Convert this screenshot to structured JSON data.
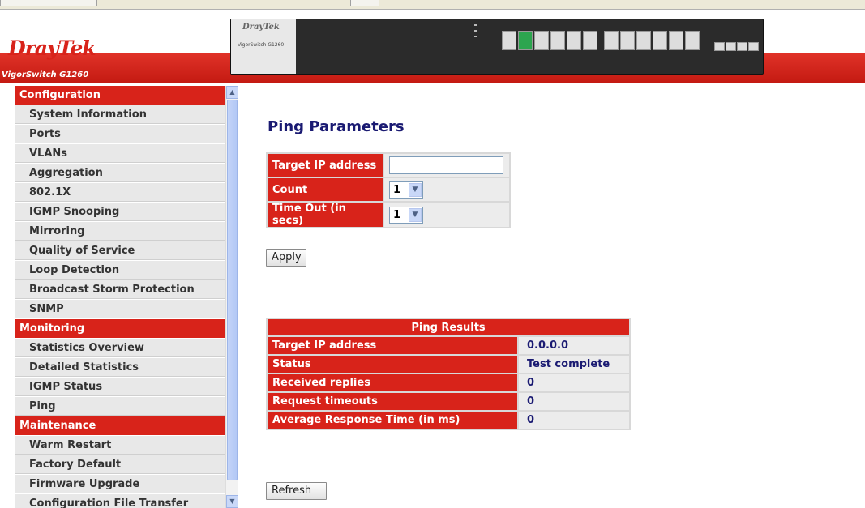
{
  "brand": {
    "logo_dray": "Dray",
    "logo_tek": "Tek",
    "model": "VigorSwitch G1260",
    "plate_logo": "DrayTek",
    "plate_model": "VigorSwitch G1260"
  },
  "menu": {
    "sections": [
      {
        "header": "Configuration",
        "items": [
          "System Information",
          "Ports",
          "VLANs",
          "Aggregation",
          "802.1X",
          "IGMP Snooping",
          "Mirroring",
          "Quality of Service",
          "Loop Detection",
          "Broadcast Storm Protection",
          "SNMP"
        ]
      },
      {
        "header": "Monitoring",
        "items": [
          "Statistics Overview",
          "Detailed Statistics",
          "IGMP Status",
          "Ping"
        ]
      },
      {
        "header": "Maintenance",
        "items": [
          "Warm Restart",
          "Factory Default",
          "Firmware Upgrade",
          "Configuration File Transfer"
        ]
      }
    ]
  },
  "ping": {
    "title": "Ping Parameters",
    "target_label": "Target IP address",
    "target_value": "",
    "count_label": "Count",
    "count_value": "1",
    "timeout_label": "Time Out (in secs)",
    "timeout_value": "1",
    "apply_label": "Apply"
  },
  "results": {
    "title": "Ping Results",
    "rows": [
      {
        "label": "Target IP address",
        "value": "0.0.0.0"
      },
      {
        "label": "Status",
        "value": "Test complete"
      },
      {
        "label": "Received replies",
        "value": "0"
      },
      {
        "label": "Request timeouts",
        "value": "0"
      },
      {
        "label": "Average Response Time (in ms)",
        "value": "0"
      }
    ],
    "refresh_label": "Refresh"
  },
  "colors": {
    "brand_red": "#d8231a",
    "title_navy": "#1a1a72",
    "cell_gray": "#ececec"
  }
}
